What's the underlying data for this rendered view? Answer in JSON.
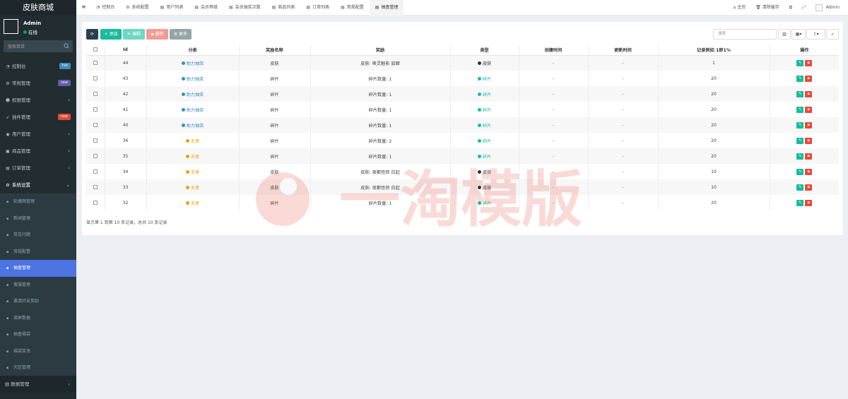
{
  "app": {
    "title": "皮肤商城"
  },
  "user": {
    "name": "Admin",
    "status": "在线"
  },
  "sidebar": {
    "search_placeholder": "搜索菜单",
    "items": [
      {
        "label": "控制台",
        "icon": "dashboard-icon",
        "badge": "hot",
        "badge_color": "#3c8dbc"
      },
      {
        "label": "常规管理",
        "icon": "cogs-icon",
        "badge": "new",
        "badge_color": "#605ca8"
      },
      {
        "label": "权限管理",
        "icon": "group-icon",
        "arrow": true
      },
      {
        "label": "插件管理",
        "icon": "rocket-icon",
        "badge": "new",
        "badge_color": "#dd4b39"
      },
      {
        "label": "用户管理",
        "icon": "user-circle-icon",
        "arrow": true
      },
      {
        "label": "商品管理",
        "icon": "cube-icon",
        "arrow": true
      },
      {
        "label": "订单管理",
        "icon": "print-icon",
        "arrow": true
      },
      {
        "label": "系统设置",
        "icon": "gear-icon",
        "open": true
      }
    ],
    "sub_items": [
      {
        "label": "轮播图管理"
      },
      {
        "label": "新闻管理"
      },
      {
        "label": "常见问题"
      },
      {
        "label": "常规配置"
      },
      {
        "label": "抽盒管理",
        "active": true
      },
      {
        "label": "客服管理"
      },
      {
        "label": "邀请好友奖励"
      },
      {
        "label": "滚屏数据"
      },
      {
        "label": "抽盒福袋"
      },
      {
        "label": "福袋奖池"
      },
      {
        "label": "大区管理"
      }
    ],
    "bottom_item": {
      "label": "数据管理"
    }
  },
  "topbar": {
    "tabs": [
      {
        "label": "控制台",
        "icon": "dashboard-icon"
      },
      {
        "label": "系统配置",
        "icon": "gear-icon"
      },
      {
        "label": "用户列表",
        "icon": "list-icon"
      },
      {
        "label": "会员等级",
        "icon": "list-icon"
      },
      {
        "label": "会员抽奖次数",
        "icon": "list-icon"
      },
      {
        "label": "商品列表",
        "icon": "list-icon"
      },
      {
        "label": "订单列表",
        "icon": "list-icon"
      },
      {
        "label": "常规配置",
        "icon": "list-icon"
      },
      {
        "label": "抽盒管理",
        "icon": "list-icon",
        "active": true
      }
    ],
    "home_label": "主页",
    "clear_cache_label": "清除缓存",
    "admin_label": "Admin"
  },
  "toolbar": {
    "add_label": "添加",
    "edit_label": "编辑",
    "delete_label": "删除",
    "more_label": "更多",
    "search_placeholder": "搜索"
  },
  "table": {
    "columns": [
      "Id",
      "分类",
      "奖励名称",
      "奖励",
      "类型",
      "创建时间",
      "更新时间",
      "记录例如 1即1%",
      "操作"
    ],
    "rows": [
      {
        "id": "44",
        "category": "助力抽奖",
        "cat_color": "#3c8dbc",
        "name": "皮肤",
        "reward": "皮肤: 唤灵魅影 貂蝉",
        "type": "皮肤",
        "type_color": "#333333",
        "created": "-",
        "updated": "-",
        "rate": "1"
      },
      {
        "id": "43",
        "category": "助力抽奖",
        "cat_color": "#3c8dbc",
        "name": "碎片",
        "reward": "碎片数量: 1",
        "type": "碎片",
        "type_color": "#18bc9c",
        "created": "-",
        "updated": "-",
        "rate": "20"
      },
      {
        "id": "42",
        "category": "助力抽奖",
        "cat_color": "#3c8dbc",
        "name": "碎片",
        "reward": "碎片数量: 1",
        "type": "碎片",
        "type_color": "#18bc9c",
        "created": "-",
        "updated": "-",
        "rate": "20"
      },
      {
        "id": "41",
        "category": "助力抽奖",
        "cat_color": "#3c8dbc",
        "name": "碎片",
        "reward": "碎片数量: 1",
        "type": "碎片",
        "type_color": "#18bc9c",
        "created": "-",
        "updated": "-",
        "rate": "20"
      },
      {
        "id": "40",
        "category": "助力抽奖",
        "cat_color": "#3c8dbc",
        "name": "碎片",
        "reward": "碎片数量: 1",
        "type": "碎片",
        "type_color": "#18bc9c",
        "created": "-",
        "updated": "-",
        "rate": "20"
      },
      {
        "id": "36",
        "category": "王者",
        "cat_color": "#f39c12",
        "name": "碎片",
        "reward": "碎片数量: 2",
        "type": "碎片",
        "type_color": "#18bc9c",
        "created": "-",
        "updated": "-",
        "rate": "20"
      },
      {
        "id": "35",
        "category": "王者",
        "cat_color": "#f39c12",
        "name": "碎片",
        "reward": "碎片数量: 1",
        "type": "碎片",
        "type_color": "#18bc9c",
        "created": "-",
        "updated": "-",
        "rate": "20"
      },
      {
        "id": "34",
        "category": "王者",
        "cat_color": "#f39c12",
        "name": "皮肤",
        "reward": "皮肤: 夜都怪侠 白起",
        "type": "皮肤",
        "type_color": "#333333",
        "created": "-",
        "updated": "-",
        "rate": "10"
      },
      {
        "id": "33",
        "category": "王者",
        "cat_color": "#f39c12",
        "name": "皮肤",
        "reward": "皮肤: 夜都怪侠 白起",
        "type": "皮肤",
        "type_color": "#333333",
        "created": "-",
        "updated": "-",
        "rate": "10"
      },
      {
        "id": "32",
        "category": "王者",
        "cat_color": "#f39c12",
        "name": "碎片",
        "reward": "碎片数量: 1",
        "type": "碎片",
        "type_color": "#18bc9c",
        "created": "-",
        "updated": "-",
        "rate": "20"
      }
    ]
  },
  "pagination": {
    "summary": "显示第 1 到第 10 条记录，总共 10 条记录"
  },
  "watermark": {
    "text": "一淘模版"
  }
}
